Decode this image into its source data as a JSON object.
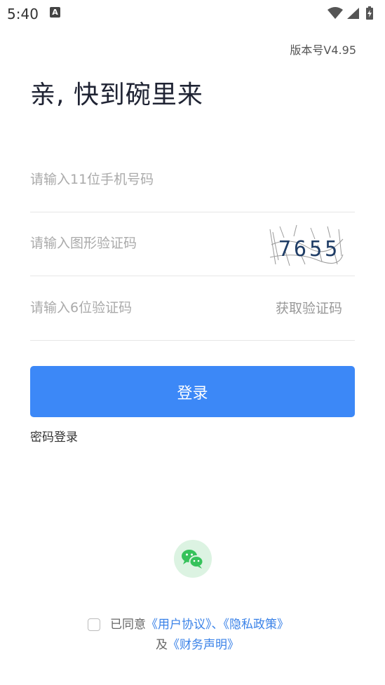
{
  "status_bar": {
    "time": "5:40",
    "notification_icon": "a-icon",
    "icons": [
      "wifi-icon",
      "signal-icon",
      "battery-charging-icon"
    ]
  },
  "header": {
    "version": "版本号V4.95",
    "title": "亲, 快到碗里来"
  },
  "form": {
    "phone_placeholder": "请输入11位手机号码",
    "captcha_placeholder": "请输入图形验证码",
    "captcha_text": "7655",
    "sms_placeholder": "请输入6位验证码",
    "sms_button": "获取验证码",
    "login_button": "登录",
    "password_login": "密码登录"
  },
  "third_party": {
    "wechat_icon": "wechat-icon"
  },
  "agreement": {
    "prefix": "已同意",
    "user_agreement": "《用户协议》",
    "separator": "、",
    "privacy_policy": "《隐私政策》",
    "and": "及",
    "finance_statement": "《财务声明》"
  },
  "colors": {
    "primary": "#3c88f7",
    "link": "#3a82e8",
    "wechat_bg": "#dcf3e2",
    "wechat_green": "#36c25b"
  }
}
